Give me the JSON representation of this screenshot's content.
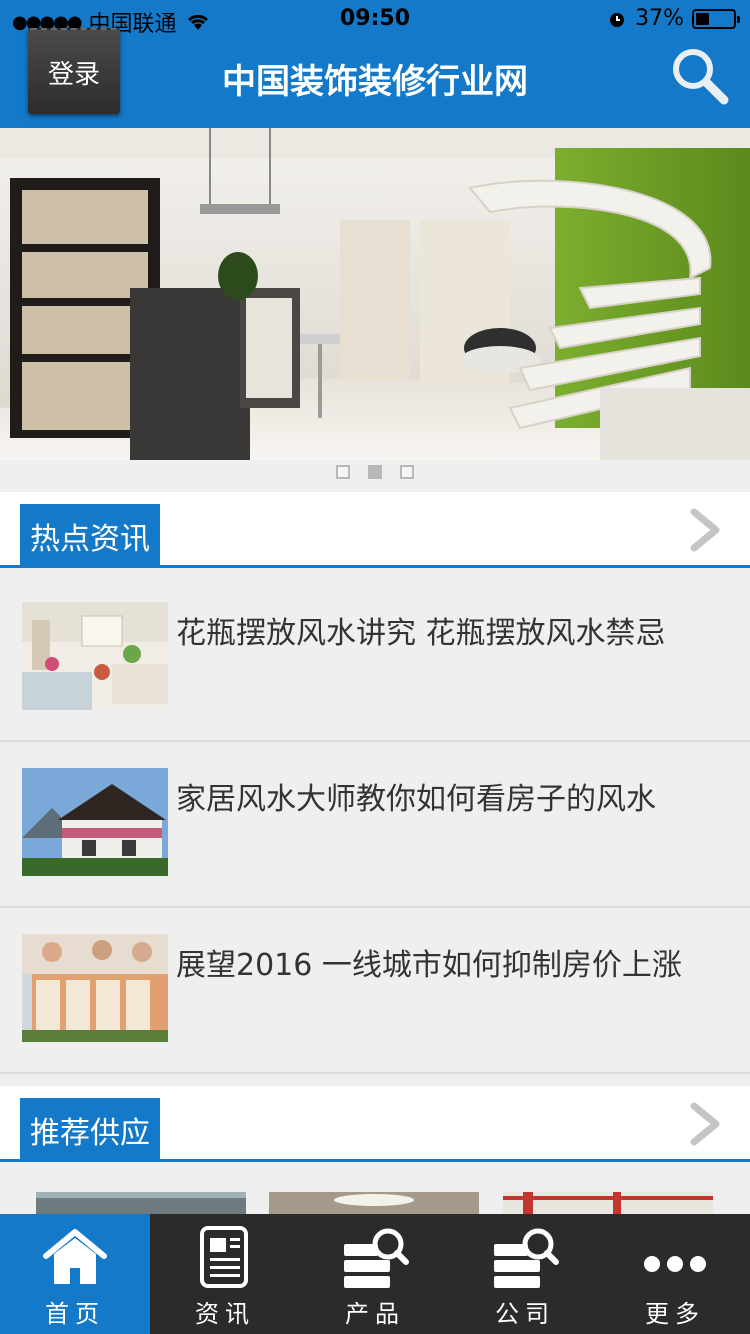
{
  "status_bar": {
    "carrier": "中国联通",
    "time": "09:50",
    "battery_text": "37%",
    "battery_level": 0.37
  },
  "nav": {
    "login_label": "登录",
    "title": "中国装饰装修行业网",
    "search_icon": "search-icon"
  },
  "banner": {
    "pages": 3,
    "active_page": 2
  },
  "hot_news": {
    "header": "热点资讯",
    "items": [
      {
        "title": "花瓶摆放风水讲究 花瓶摆放风水禁忌"
      },
      {
        "title": "家居风水大师教你如何看房子的风水"
      },
      {
        "title": "展望2016 一线城市如何抑制房价上涨"
      }
    ]
  },
  "supply": {
    "header": "推荐供应"
  },
  "tabbar": {
    "items": [
      {
        "label": "首页",
        "icon": "home-icon",
        "active": true
      },
      {
        "label": "资讯",
        "icon": "news-icon",
        "active": false
      },
      {
        "label": "产品",
        "icon": "product-search-icon",
        "active": false
      },
      {
        "label": "公司",
        "icon": "company-search-icon",
        "active": false
      },
      {
        "label": "更多",
        "icon": "more-icon",
        "active": false
      }
    ]
  },
  "colors": {
    "brand_blue": "#1479c9",
    "tabbar_dark": "#2b2b2b"
  }
}
